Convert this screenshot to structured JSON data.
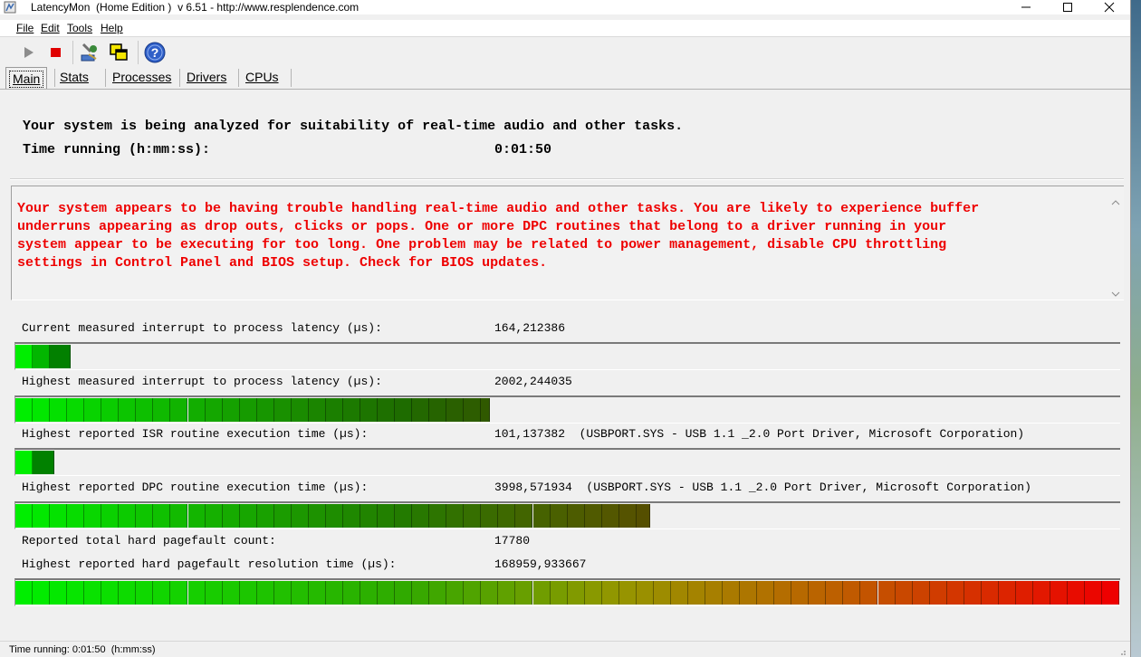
{
  "window": {
    "title": "LatencyMon  (Home Edition )  v 6.51 - http://www.resplendence.com",
    "app_icon": "latencymon-icon",
    "controls": [
      "minimize-icon",
      "maximize-icon",
      "close-icon"
    ]
  },
  "menu": {
    "file": "File",
    "edit": "Edit",
    "tools": "Tools",
    "help": "Help"
  },
  "toolbar": {
    "buttons": [
      {
        "name": "start",
        "icon": "play-icon"
      },
      {
        "name": "stop",
        "icon": "stop-icon",
        "color": "#e00000"
      },
      {
        "name": "tools",
        "icon": "tools-icon"
      },
      {
        "name": "windows",
        "icon": "windows-icon"
      },
      {
        "name": "help",
        "icon": "help-icon"
      }
    ]
  },
  "tabs": [
    {
      "label": "Main",
      "active": true
    },
    {
      "label": "Stats"
    },
    {
      "label": "Processes"
    },
    {
      "label": "Drivers"
    },
    {
      "label": "CPUs"
    }
  ],
  "main": {
    "analysis_text": "Your system is being analyzed for suitability of real-time audio and other tasks.",
    "time_label": "Time running (h:mm:ss):",
    "time_value": "0:01:50",
    "warning_color": "#ee0000",
    "warning_text": "Your system appears to be having trouble handling real-time audio and other tasks. You are likely to experience buffer\nunderruns appearing as drop outs, clicks or pops. One or more DPC routines that belong to a driver running in your\nsystem appear to be executing for too long. One problem may be related to power management, disable CPU throttling\nsettings in Control Panel and BIOS setup. Check for BIOS updates."
  },
  "stats": [
    {
      "label": "Current measured interrupt to process latency (µs):",
      "value": "164,212386",
      "level": 0.05
    },
    {
      "label": "Highest measured interrupt to process latency (µs):",
      "value": "2002,244035",
      "level": 0.43
    },
    {
      "label": "Highest reported ISR routine execution time (µs):",
      "value": "101,137382  (USBPORT.SYS - USB 1.1 _2.0 Port Driver, Microsoft Corporation)",
      "level": 0.035
    },
    {
      "label": "Highest reported DPC routine execution time (µs):",
      "value": "3998,571934  (USBPORT.SYS - USB 1.1 _2.0 Port Driver, Microsoft Corporation)",
      "level": 0.575
    },
    {
      "label": "Reported total hard pagefault count:",
      "value": "17780"
    },
    {
      "label": "Highest reported hard pagefault resolution time (µs):",
      "value": "168959,933667",
      "level": 1.0
    }
  ],
  "status": {
    "text": "Time running: 0:01:50  (h:mm:ss)"
  }
}
